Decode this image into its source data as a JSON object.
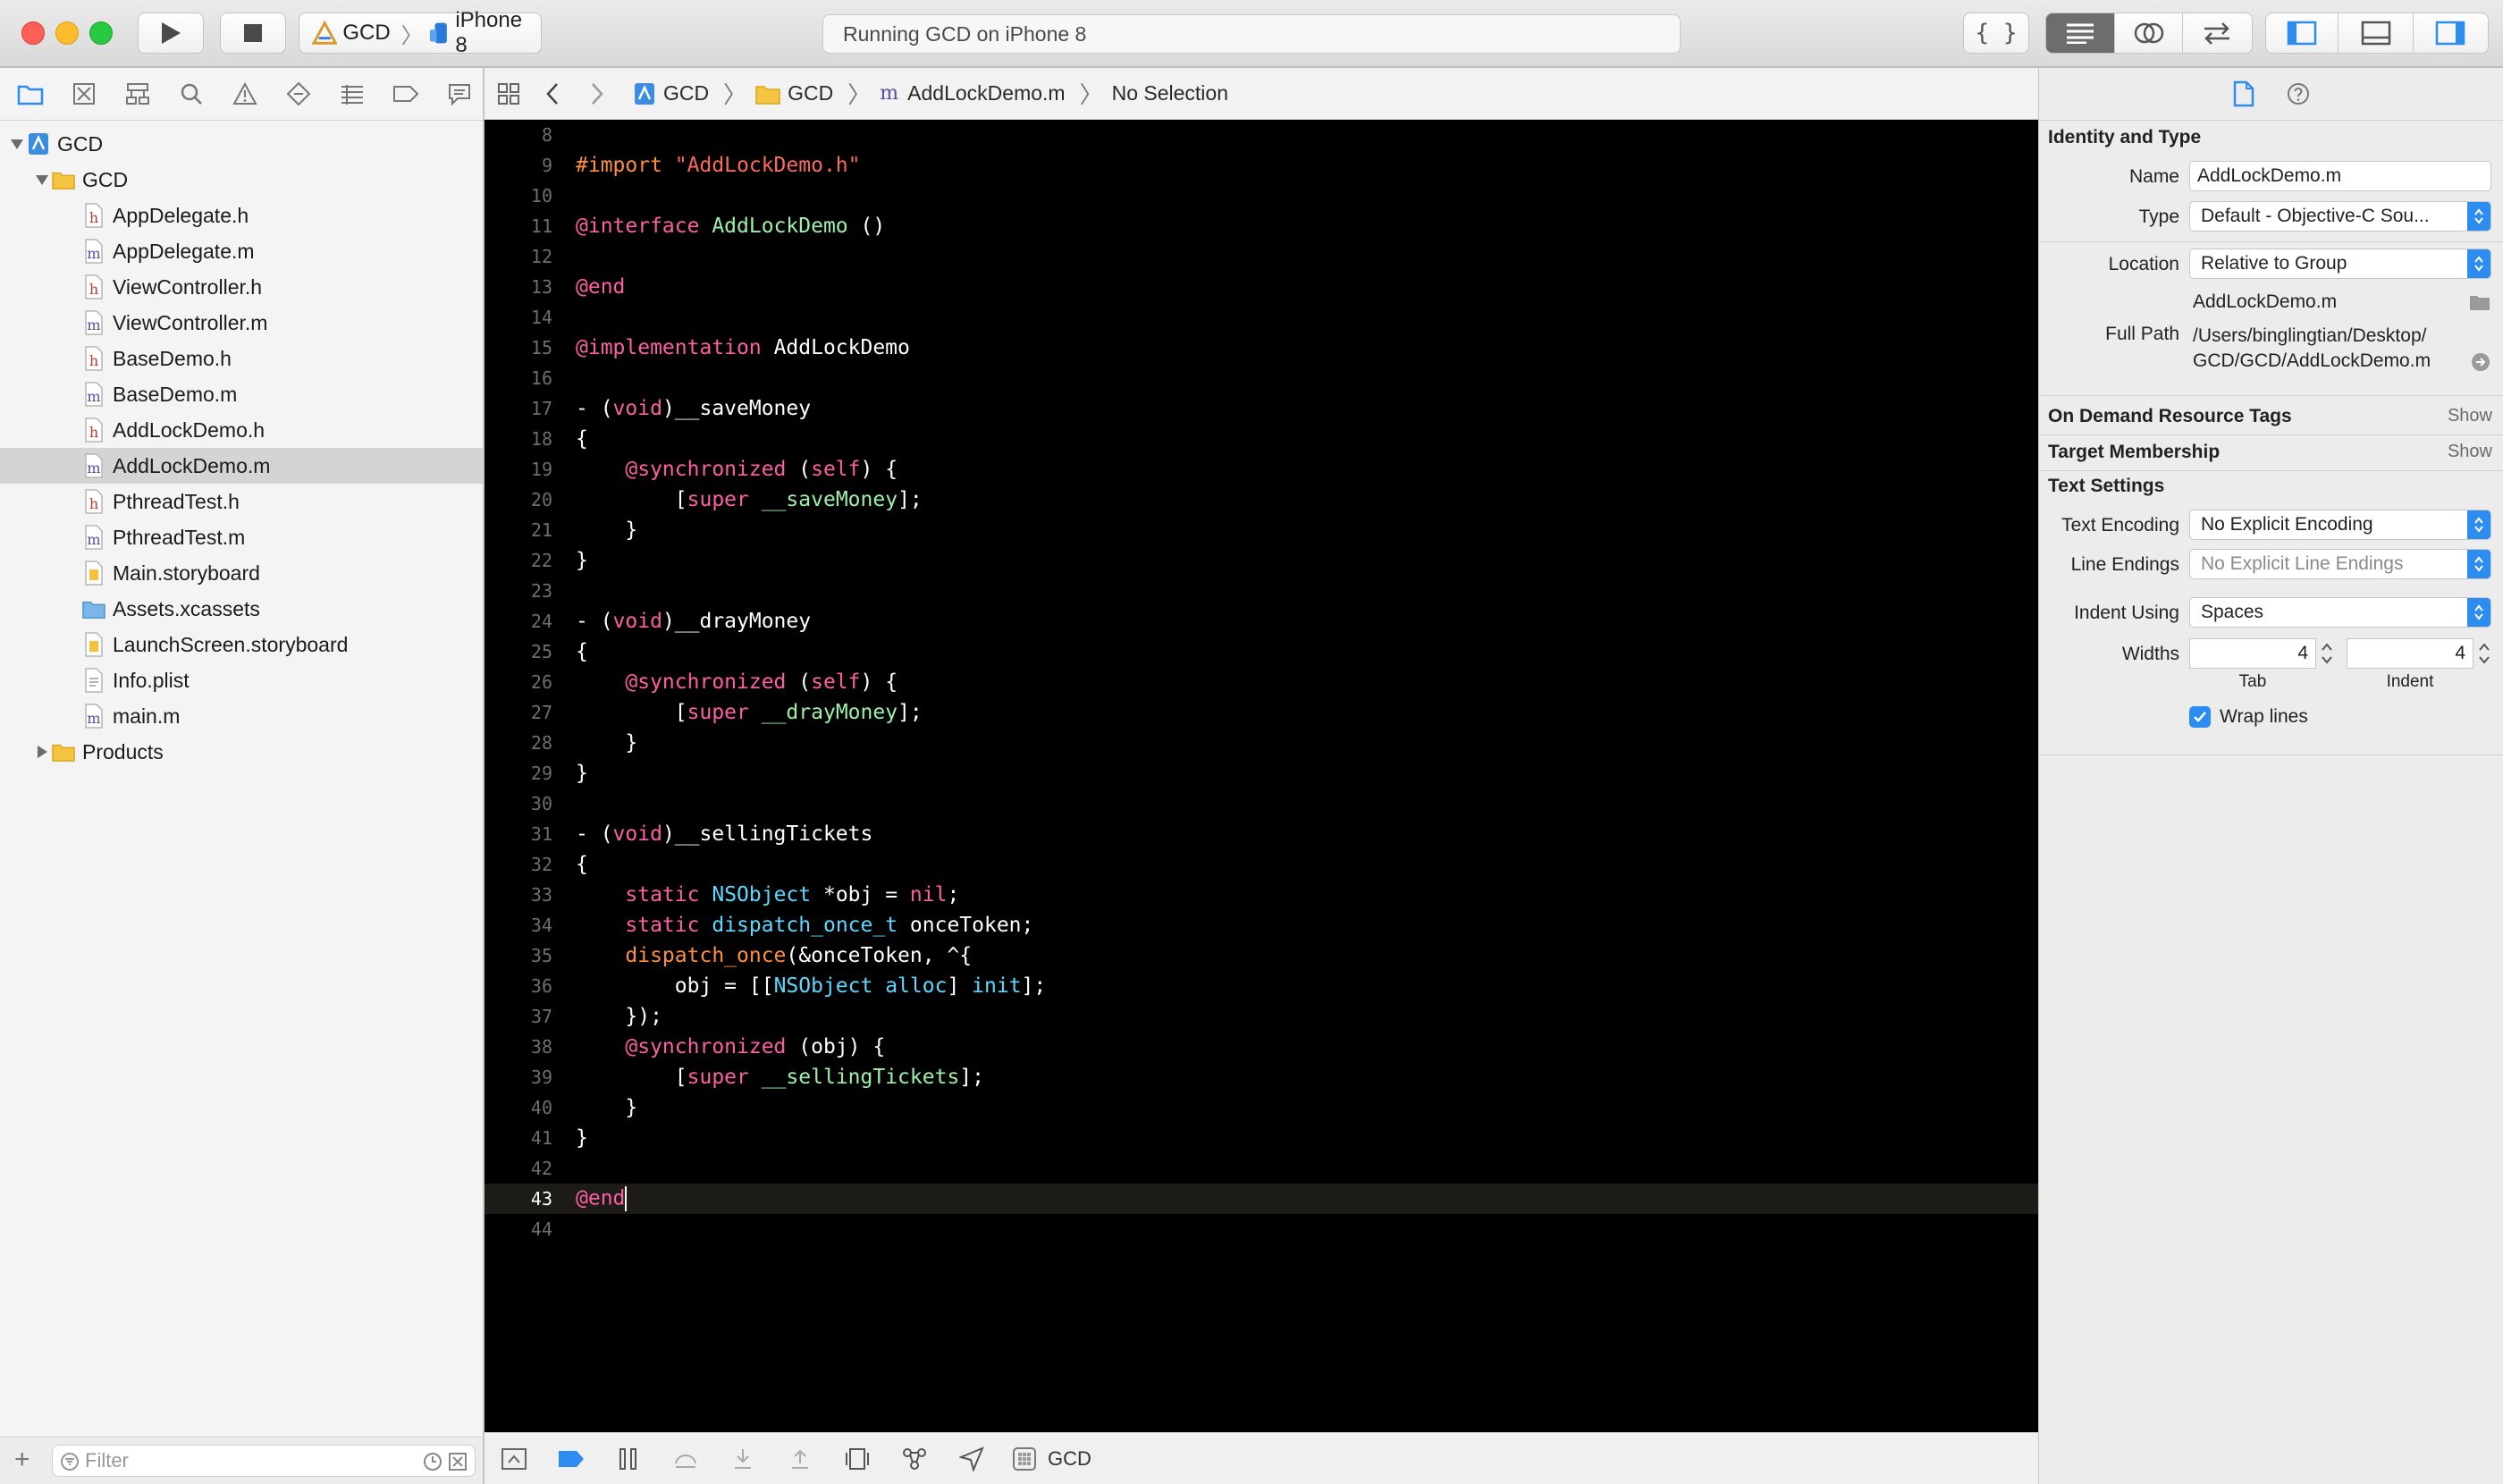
{
  "toolbar": {
    "scheme_target": "GCD",
    "scheme_device": "iPhone 8",
    "activity_status": "Running GCD on iPhone 8"
  },
  "navigator": {
    "root": "GCD",
    "group": "GCD",
    "files": [
      {
        "name": "AppDelegate.h",
        "kind": "h"
      },
      {
        "name": "AppDelegate.m",
        "kind": "m"
      },
      {
        "name": "ViewController.h",
        "kind": "h"
      },
      {
        "name": "ViewController.m",
        "kind": "m"
      },
      {
        "name": "BaseDemo.h",
        "kind": "h"
      },
      {
        "name": "BaseDemo.m",
        "kind": "m"
      },
      {
        "name": "AddLockDemo.h",
        "kind": "h"
      },
      {
        "name": "AddLockDemo.m",
        "kind": "m",
        "selected": true
      },
      {
        "name": "PthreadTest.h",
        "kind": "h"
      },
      {
        "name": "PthreadTest.m",
        "kind": "m"
      },
      {
        "name": "Main.storyboard",
        "kind": "storyboard"
      },
      {
        "name": "Assets.xcassets",
        "kind": "assets"
      },
      {
        "name": "LaunchScreen.storyboard",
        "kind": "storyboard"
      },
      {
        "name": "Info.plist",
        "kind": "plist"
      },
      {
        "name": "main.m",
        "kind": "m"
      }
    ],
    "products": "Products",
    "filter_placeholder": "Filter"
  },
  "jumpbar": {
    "crumbs": [
      "GCD",
      "GCD",
      "AddLockDemo.m",
      "No Selection"
    ]
  },
  "editor": {
    "current_line": 43,
    "lines": [
      {
        "n": "8",
        "tokens": []
      },
      {
        "n": "9",
        "tokens": [
          [
            "pre",
            "#import "
          ],
          [
            "str",
            "\"AddLockDemo.h\""
          ]
        ]
      },
      {
        "n": "10",
        "tokens": []
      },
      {
        "n": "11",
        "tokens": [
          [
            "kw",
            "@interface "
          ],
          [
            "prj",
            "AddLockDemo"
          ],
          [
            "plain",
            " ()"
          ]
        ]
      },
      {
        "n": "12",
        "tokens": []
      },
      {
        "n": "13",
        "tokens": [
          [
            "kw",
            "@end"
          ]
        ]
      },
      {
        "n": "14",
        "tokens": []
      },
      {
        "n": "15",
        "tokens": [
          [
            "kw",
            "@implementation "
          ],
          [
            "plain",
            "AddLockDemo"
          ]
        ]
      },
      {
        "n": "16",
        "tokens": []
      },
      {
        "n": "17",
        "tokens": [
          [
            "plain",
            "- ("
          ],
          [
            "kw",
            "void"
          ],
          [
            "plain",
            ")__saveMoney"
          ]
        ]
      },
      {
        "n": "18",
        "tokens": [
          [
            "plain",
            "{"
          ]
        ]
      },
      {
        "n": "19",
        "tokens": [
          [
            "plain",
            "    "
          ],
          [
            "kw",
            "@synchronized"
          ],
          [
            "plain",
            " ("
          ],
          [
            "kw",
            "self"
          ],
          [
            "plain",
            ") {"
          ]
        ]
      },
      {
        "n": "20",
        "tokens": [
          [
            "plain",
            "        ["
          ],
          [
            "kw",
            "super"
          ],
          [
            "plain",
            " "
          ],
          [
            "prj",
            "__saveMoney"
          ],
          [
            "plain",
            "];"
          ]
        ]
      },
      {
        "n": "21",
        "tokens": [
          [
            "plain",
            "    }"
          ]
        ]
      },
      {
        "n": "22",
        "tokens": [
          [
            "plain",
            "}"
          ]
        ]
      },
      {
        "n": "23",
        "tokens": []
      },
      {
        "n": "24",
        "tokens": [
          [
            "plain",
            "- ("
          ],
          [
            "kw",
            "void"
          ],
          [
            "plain",
            ")__drayMoney"
          ]
        ]
      },
      {
        "n": "25",
        "tokens": [
          [
            "plain",
            "{"
          ]
        ]
      },
      {
        "n": "26",
        "tokens": [
          [
            "plain",
            "    "
          ],
          [
            "kw",
            "@synchronized"
          ],
          [
            "plain",
            " ("
          ],
          [
            "kw",
            "self"
          ],
          [
            "plain",
            ") {"
          ]
        ]
      },
      {
        "n": "27",
        "tokens": [
          [
            "plain",
            "        ["
          ],
          [
            "kw",
            "super"
          ],
          [
            "plain",
            " "
          ],
          [
            "prj",
            "__drayMoney"
          ],
          [
            "plain",
            "];"
          ]
        ]
      },
      {
        "n": "28",
        "tokens": [
          [
            "plain",
            "    }"
          ]
        ]
      },
      {
        "n": "29",
        "tokens": [
          [
            "plain",
            "}"
          ]
        ]
      },
      {
        "n": "30",
        "tokens": []
      },
      {
        "n": "31",
        "tokens": [
          [
            "plain",
            "- ("
          ],
          [
            "kw",
            "void"
          ],
          [
            "plain",
            ")__sellingTickets"
          ]
        ]
      },
      {
        "n": "32",
        "tokens": [
          [
            "plain",
            "{"
          ]
        ]
      },
      {
        "n": "33",
        "tokens": [
          [
            "plain",
            "    "
          ],
          [
            "kw",
            "static"
          ],
          [
            "plain",
            " "
          ],
          [
            "typ",
            "NSObject"
          ],
          [
            "plain",
            " *obj = "
          ],
          [
            "kw",
            "nil"
          ],
          [
            "plain",
            ";"
          ]
        ]
      },
      {
        "n": "34",
        "tokens": [
          [
            "plain",
            "    "
          ],
          [
            "kw",
            "static"
          ],
          [
            "plain",
            " "
          ],
          [
            "typ",
            "dispatch_once_t"
          ],
          [
            "plain",
            " onceToken;"
          ]
        ]
      },
      {
        "n": "35",
        "tokens": [
          [
            "plain",
            "    "
          ],
          [
            "pre",
            "dispatch_once"
          ],
          [
            "plain",
            "(&onceToken, ^{"
          ]
        ]
      },
      {
        "n": "36",
        "tokens": [
          [
            "plain",
            "        obj = [["
          ],
          [
            "typ",
            "NSObject"
          ],
          [
            "plain",
            " "
          ],
          [
            "typ",
            "alloc"
          ],
          [
            "plain",
            "] "
          ],
          [
            "typ",
            "init"
          ],
          [
            "plain",
            "];"
          ]
        ]
      },
      {
        "n": "37",
        "tokens": [
          [
            "plain",
            "    });"
          ]
        ]
      },
      {
        "n": "38",
        "tokens": [
          [
            "plain",
            "    "
          ],
          [
            "kw",
            "@synchronized"
          ],
          [
            "plain",
            " (obj) {"
          ]
        ]
      },
      {
        "n": "39",
        "tokens": [
          [
            "plain",
            "        ["
          ],
          [
            "kw",
            "super"
          ],
          [
            "plain",
            " "
          ],
          [
            "prj",
            "__sellingTickets"
          ],
          [
            "plain",
            "];"
          ]
        ]
      },
      {
        "n": "40",
        "tokens": [
          [
            "plain",
            "    }"
          ]
        ]
      },
      {
        "n": "41",
        "tokens": [
          [
            "plain",
            "}"
          ]
        ]
      },
      {
        "n": "42",
        "tokens": []
      },
      {
        "n": "43",
        "tokens": [
          [
            "kw",
            "@end"
          ]
        ]
      },
      {
        "n": "44",
        "tokens": []
      }
    ]
  },
  "debugbar": {
    "process": "GCD"
  },
  "inspector": {
    "identity_title": "Identity and Type",
    "name_label": "Name",
    "name_value": "AddLockDemo.m",
    "type_label": "Type",
    "type_value": "Default - Objective-C Sou...",
    "location_label": "Location",
    "location_value": "Relative to Group",
    "location_file": "AddLockDemo.m",
    "fullpath_label": "Full Path",
    "fullpath_line1": "/Users/binglingtian/Desktop/",
    "fullpath_line2": "GCD/GCD/AddLockDemo.m",
    "odr_title": "On Demand Resource Tags",
    "target_title": "Target Membership",
    "show_label": "Show",
    "text_settings_title": "Text Settings",
    "encoding_label": "Text Encoding",
    "encoding_value": "No Explicit Encoding",
    "line_endings_label": "Line Endings",
    "line_endings_value": "No Explicit Line Endings",
    "indent_using_label": "Indent Using",
    "indent_using_value": "Spaces",
    "widths_label": "Widths",
    "tab_width": "4",
    "indent_width": "4",
    "tab_caption": "Tab",
    "indent_caption": "Indent",
    "wrap_lines_label": "Wrap lines",
    "wrap_lines_checked": true
  },
  "colors": {
    "keyword": "#fc5fa3",
    "string": "#fc6a5d",
    "preprocessor": "#fd8f3f",
    "type": "#5dd8ff",
    "project_symbol": "#9ef0a9",
    "accent": "#2d8cf0"
  }
}
